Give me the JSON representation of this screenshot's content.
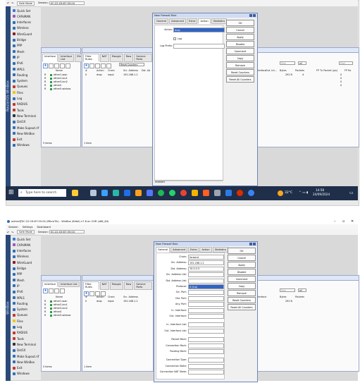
{
  "top": {
    "toolbar": {
      "safe_mode": "Safe Mode",
      "session_label": "Session:",
      "session_value": "0C:22:C6:67:55:04"
    },
    "menu": [
      "Quick Set",
      "CAPsMAN",
      "Interfaces",
      "Wireless",
      "WireGuard",
      "Bridge",
      "PPP",
      "Mesh",
      "IP",
      "IPv6",
      "MPLS",
      "Routing",
      "System",
      "Queues",
      "Files",
      "Log",
      "RADIUS",
      "Tools",
      "New Terminal",
      "Dot1X",
      "Make Supout.rif",
      "New WinBox",
      "Exit",
      "Windows"
    ],
    "menu_colors": [
      "#3a7bd5",
      "#9b59b6",
      "#2d6fb8",
      "#2d6fb8",
      "#8b1e1e",
      "#2d6fb8",
      "#2d6fb8",
      "#2d6fb8",
      "#2d6fb8",
      "#2d6fb8",
      "#2d6fb8",
      "#2d6fb8",
      "#2d6fb8",
      "#c0392b",
      "#f1c40f",
      "#2d6fb8",
      "#c0392b",
      "#c0392b",
      "#333333",
      "#2d6fb8",
      "#2d6fb8",
      "#2d6fb8",
      "#c0392b",
      "#2d6fb8"
    ],
    "sidebar_brand": "RouterOS WinBox",
    "iface_window": {
      "tabs": [
        "Interface",
        "Interface List",
        "Eth"
      ],
      "headers": [
        "Name"
      ],
      "rows": [
        {
          "flag": "R",
          "name": "ether1-wan"
        },
        {
          "flag": "R",
          "name": "ether2-lan1"
        },
        {
          "flag": "R",
          "name": "ether3-lan2"
        },
        {
          "flag": "R",
          "name": "ether4"
        },
        {
          "flag": "R",
          "name": "ether5-winbox"
        }
      ],
      "footer": "5 items"
    },
    "firewall_window": {
      "tabs": [
        "Filter Rules",
        "NAT",
        "Mangle",
        "Raw",
        "Service Ports",
        "C"
      ],
      "headers": [
        "#",
        "Action",
        "Chain",
        "Src. Address",
        "Dst. Ad"
      ],
      "reset_btn": "Reset Counters",
      "row": {
        "num": "0",
        "action": "drop",
        "chain": "input",
        "src": "192.168.1.2"
      },
      "footer": "1 item",
      "right_headers": [
        "Interface",
        "Out. Int...",
        "Bytes",
        "Packets"
      ],
      "right_values": {
        "bytes": "292 B",
        "packets": "4"
      },
      "find_placeholder": "Find",
      "all_value": "all",
      "rx_headers": [
        "FP Tx Packet (p/s)",
        "FP Rx"
      ],
      "rx_values": [
        "0",
        "0",
        "0",
        "0"
      ]
    },
    "dialog": {
      "title": "New Firewall Rule",
      "tabs": [
        "General",
        "Advanced",
        "Extra",
        "Action",
        "Statistics"
      ],
      "action_label": "Action:",
      "action_value": "drop",
      "log_label": "Log",
      "log_prefix_label": "Log Prefix:",
      "status": "enabled",
      "buttons": [
        "OK",
        "Cancel",
        "Apply",
        "Disable",
        "Comment",
        "Copy",
        "Remove",
        "Reset Counters",
        "Reset All Counters"
      ]
    },
    "taskbar": {
      "search": "Type here to search",
      "temp": "32°C",
      "time": "14:58",
      "date": "24/09/2024"
    }
  },
  "bottom": {
    "window_title": "admin@0C:22:C6:67:55:04 (MikroTik) - WinBox (64bit) v7.8 on CHR (x86_64)",
    "app_menu": [
      "Session",
      "Settings",
      "Dashboard"
    ],
    "toolbar": {
      "safe_mode": "Safe Mode",
      "session_label": "Session:",
      "session_value": "0C:22:C6:67:55:04"
    },
    "sidebar_brand": "WinBox",
    "dialog": {
      "title": "New Firewall Rule",
      "tabs": [
        "General",
        "Advanced",
        "Extra",
        "Action",
        "Statistics"
      ],
      "fields": [
        {
          "label": "Chain:",
          "value": "forward"
        },
        {
          "label": "Src. Address:",
          "value": "192.168.1.2"
        },
        {
          "label": "Dst. Address:",
          "value": "10.0.0.3"
        },
        {
          "label": "Src. Address List:",
          "value": ""
        },
        {
          "label": "Dst. Address List:",
          "value": ""
        },
        {
          "label": "Protocol:",
          "value": "6 (tcp)"
        },
        {
          "label": "Src. Port:",
          "value": ""
        },
        {
          "label": "Dst. Port:",
          "value": ""
        },
        {
          "label": "Any. Port:",
          "value": ""
        },
        {
          "label": "In. Interface:",
          "value": ""
        },
        {
          "label": "Out. Interface:",
          "value": ""
        },
        {
          "label": "In. Interface List:",
          "value": ""
        },
        {
          "label": "Out. Interface List:",
          "value": ""
        },
        {
          "label": "Packet Mark:",
          "value": ""
        },
        {
          "label": "Connection Mark:",
          "value": ""
        },
        {
          "label": "Routing Mark:",
          "value": ""
        },
        {
          "label": "Connection Type:",
          "value": ""
        },
        {
          "label": "Connection State:",
          "value": ""
        },
        {
          "label": "Connection NAT State:",
          "value": ""
        }
      ],
      "buttons": [
        "OK",
        "Cancel",
        "Apply",
        "Disable",
        "Comment",
        "Copy",
        "Remove",
        "Reset Counters",
        "Reset All Counters"
      ]
    }
  }
}
